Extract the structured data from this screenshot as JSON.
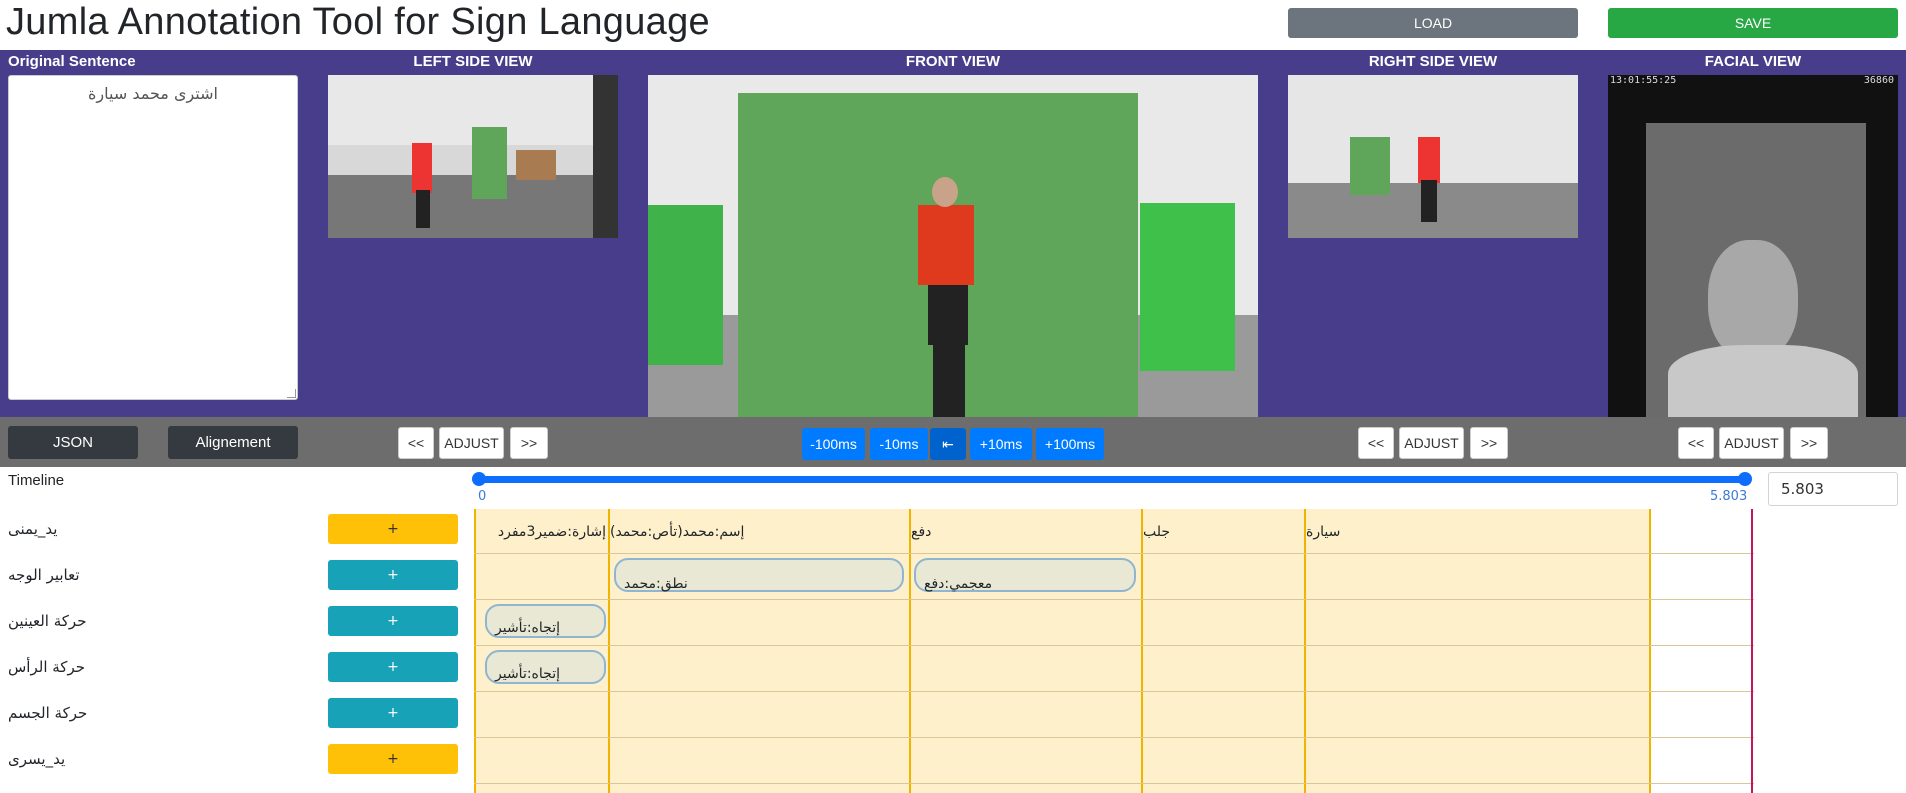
{
  "header": {
    "title": "Jumla Annotation Tool for Sign Language",
    "load_label": "LOAD",
    "save_label": "SAVE"
  },
  "views": {
    "original_sentence_title": "Original Sentence",
    "sentence": "اشترى محمد سيارة",
    "left_title": "LEFT SIDE VIEW",
    "front_title": "FRONT VIEW",
    "right_title": "RIGHT SIDE VIEW",
    "facial_title": "FACIAL VIEW",
    "facial_timecode": "13:01:55:25",
    "facial_frame": "36860"
  },
  "controls": {
    "json_label": "JSON",
    "alignment_label": "Alignement",
    "left_prev": "<<",
    "left_adjust": "ADJUST",
    "left_next": ">>",
    "minus100": "-100ms",
    "minus10": "-10ms",
    "play_icon": "⇤",
    "plus10": "+10ms",
    "plus100": "+100ms",
    "right_prev": "<<",
    "right_adjust": "ADJUST",
    "right_next": ">>",
    "face_prev": "<<",
    "face_adjust": "ADJUST",
    "face_next": ">>"
  },
  "timeline": {
    "label": "Timeline",
    "min": "0",
    "max": "5.803",
    "current": "5.803"
  },
  "tracks": [
    {
      "label": "يد_يمنى",
      "add": "+",
      "color": "#ffc107"
    },
    {
      "label": "تعابير الوجه",
      "add": "+",
      "color": "#17a2b8"
    },
    {
      "label": "حركة العينين",
      "add": "+",
      "color": "#17a2b8"
    },
    {
      "label": "حركة الرأس",
      "add": "+",
      "color": "#17a2b8"
    },
    {
      "label": "حركة الجسم",
      "add": "+",
      "color": "#17a2b8"
    },
    {
      "label": "يد_يسرى",
      "add": "+",
      "color": "#ffc107"
    }
  ],
  "segments": {
    "right_hand": [
      "إشارة:ضمير3مفرد",
      "إسم:محمد(تأص:محمد)",
      "دفع",
      "جلب",
      "سيارة"
    ],
    "face": [
      "نطق:محمد",
      "معجمي:دفع"
    ],
    "eyes": [
      "إتجاه:تأشير"
    ],
    "head": [
      "إتجاه:تأشير"
    ]
  }
}
